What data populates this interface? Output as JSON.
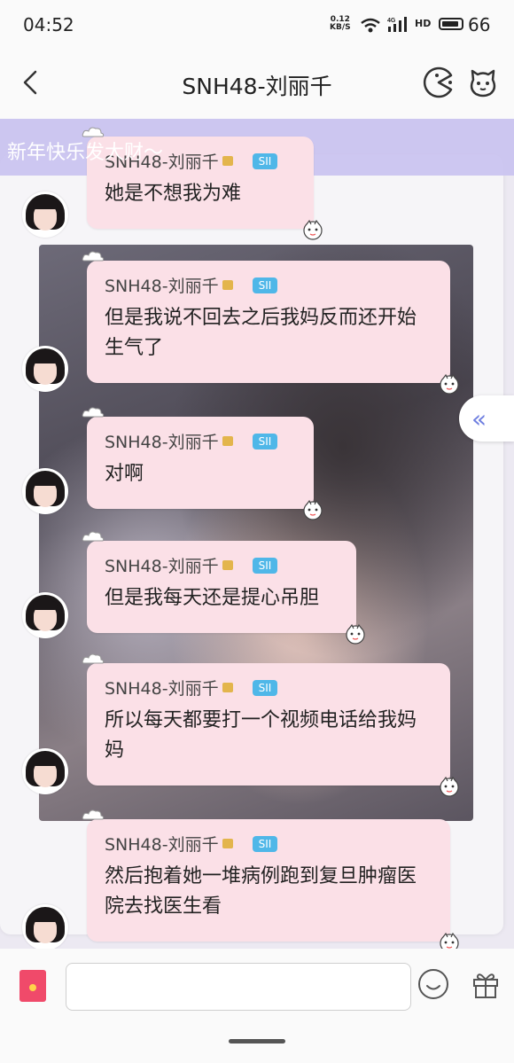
{
  "status_bar": {
    "time": "04:52",
    "net_speed_value": "0.12",
    "net_speed_unit": "KB/S",
    "signal_label": "4G",
    "hd_label": "HD",
    "battery": "66"
  },
  "header": {
    "title": "SNH48-刘丽千",
    "back_icon": "chevron-left-icon",
    "right_icons": [
      "pacman-icon",
      "pet-face-icon"
    ]
  },
  "banner": {
    "text": "新年快乐发大财～"
  },
  "messages": [
    {
      "sender": "SNH48-刘丽千",
      "tag": "SII",
      "text": "她是不想我为难"
    },
    {
      "sender": "SNH48-刘丽千",
      "tag": "SII",
      "text": "但是我说不回去之后我妈反而还开始生气了"
    },
    {
      "sender": "SNH48-刘丽千",
      "tag": "SII",
      "text": "对啊"
    },
    {
      "sender": "SNH48-刘丽千",
      "tag": "SII",
      "text": "但是我每天还是提心吊胆"
    },
    {
      "sender": "SNH48-刘丽千",
      "tag": "SII",
      "text": "所以每天都要打一个视频电话给我妈妈"
    },
    {
      "sender": "SNH48-刘丽千",
      "tag": "SII",
      "text": "然后抱着她一堆病例跑到复旦肿瘤医院去找医生看"
    }
  ],
  "side_button": {
    "icon": "double-chevron-left-icon",
    "glyph": "«"
  },
  "input_bar": {
    "placeholder": "",
    "left_icon": "red-packet-icon",
    "right_icons": [
      "emoji-icon",
      "gift-icon"
    ]
  },
  "colors": {
    "bubble": "#fbe0e7",
    "banner": "#c9c2f0",
    "tag": "#4fb7e8",
    "accent": "#6f7fe0"
  }
}
